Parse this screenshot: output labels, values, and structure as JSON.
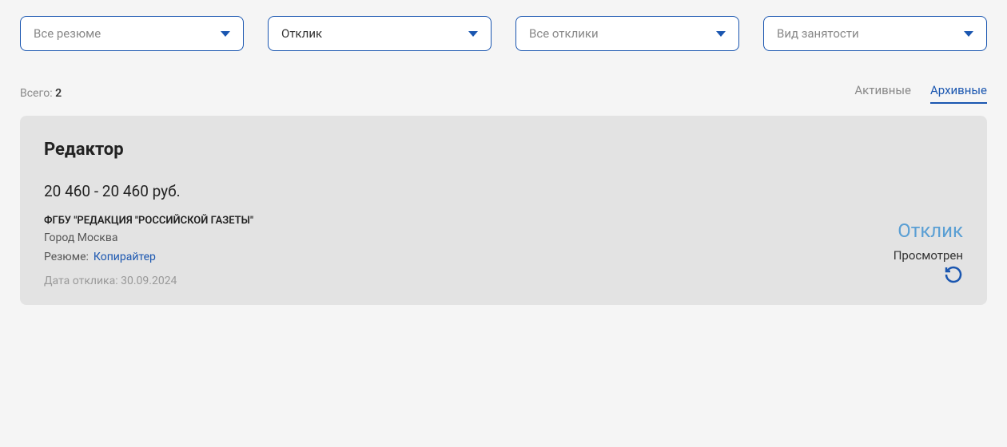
{
  "filters": {
    "resume": "Все резюме",
    "type": "Отклик",
    "responses": "Все отклики",
    "employment": "Вид занятости"
  },
  "summary": {
    "label": "Всего: ",
    "count": "2"
  },
  "tabs": {
    "active": "Активные",
    "archived": "Архивные"
  },
  "card": {
    "title": "Редактор",
    "salary": "20 460 - 20 460 руб.",
    "company": "ФГБУ \"РЕДАКЦИЯ \"РОССИЙСКОЙ ГАЗЕТЫ\"",
    "location": "Город Москва",
    "resume_label": "Резюме:",
    "resume_link": "Копирайтер",
    "date_label": "Дата отклика: 30.09.2024",
    "status_main": "Отклик",
    "status_sub": "Просмотрен"
  }
}
